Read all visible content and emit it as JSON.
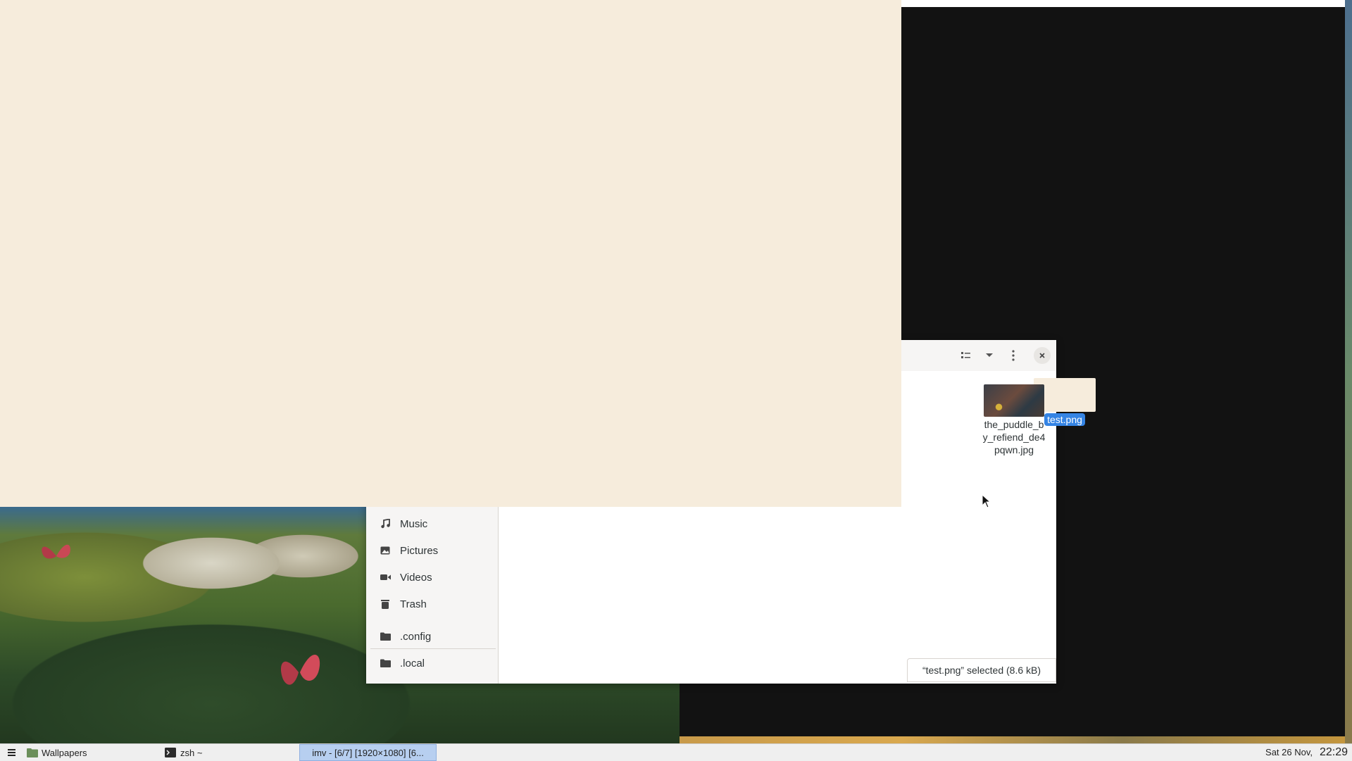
{
  "sidebar": {
    "items": [
      {
        "label": "Music",
        "icon": "music-note-icon"
      },
      {
        "label": "Pictures",
        "icon": "image-icon"
      },
      {
        "label": "Videos",
        "icon": "video-camera-icon"
      },
      {
        "label": "Trash",
        "icon": "trash-icon"
      },
      {
        "label": ".config",
        "icon": "folder-icon"
      },
      {
        "label": ".local",
        "icon": "folder-icon"
      }
    ]
  },
  "header": {
    "icons": [
      "list-view-icon",
      "dropdown-icon",
      "kebab-menu-icon",
      "close-icon"
    ]
  },
  "files": [
    {
      "name": "test.png",
      "selected": true
    },
    {
      "name": "the_puddle_by_refiend_de4pqwn.jpg",
      "selected": false
    }
  ],
  "status": {
    "text": "“test.png” selected  (8.6 kB)"
  },
  "taskbar": {
    "items": [
      {
        "label": "Wallpapers",
        "icon": "folder-icon"
      },
      {
        "label": "zsh ~",
        "icon": "terminal-icon"
      },
      {
        "label": "imv - [6/7] [1920×1080] [6...",
        "active": true
      }
    ],
    "date": "Sat 26 Nov,",
    "time": "22:29"
  },
  "colors": {
    "accent": "#3584e4",
    "image_fill": "#f6ecdc",
    "window_black": "#121212"
  }
}
